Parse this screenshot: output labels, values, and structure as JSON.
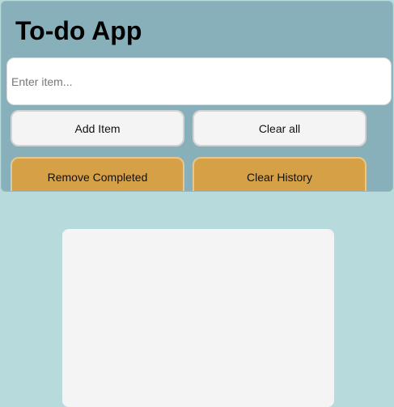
{
  "app": {
    "title": "To-do App"
  },
  "input": {
    "placeholder": "Enter item...",
    "value": ""
  },
  "buttons": {
    "add_item": "Add Item",
    "clear_all": "Clear all",
    "remove_completed": "Remove Completed",
    "clear_history": "Clear History"
  },
  "colors": {
    "page_background": "#b7dbdc",
    "header_panel": "#87b0ba",
    "accent_button": "#d6a046",
    "light_button": "#f4f4f4",
    "list_card": "#f4f4f4"
  },
  "list": {
    "items": []
  }
}
